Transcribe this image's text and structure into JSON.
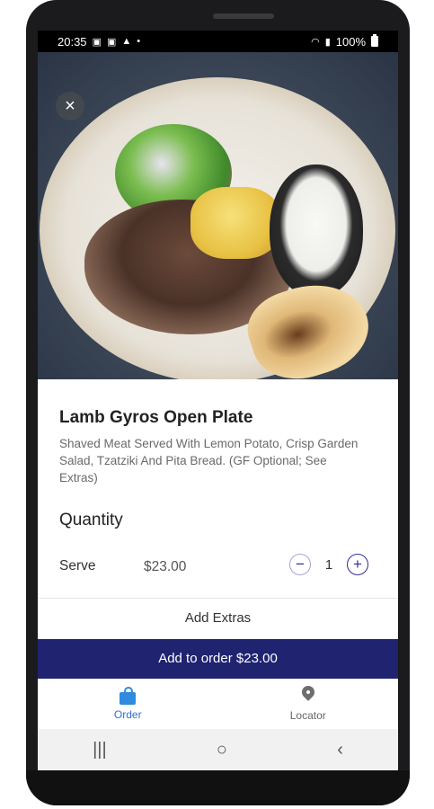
{
  "status_bar": {
    "time": "20:35",
    "battery": "100%"
  },
  "item": {
    "title": "Lamb Gyros Open Plate",
    "description": "Shaved Meat Served With Lemon Potato, Crisp Garden Salad, Tzatziki And Pita Bread. (GF Optional; See Extras)"
  },
  "quantity": {
    "title": "Quantity",
    "serve_label": "Serve",
    "price": "$23.00",
    "count": "1",
    "minus": "−",
    "plus": "+"
  },
  "extras_label": "Add Extras",
  "cta": {
    "label": "Add to order $23.00"
  },
  "nav": {
    "order_label": "Order",
    "locator_label": "Locator"
  },
  "icons": {
    "close": "×",
    "recents": "|||",
    "home": "○",
    "back": "‹"
  },
  "colors": {
    "primary": "#1f2370",
    "active_tab": "#2f6fd6"
  }
}
